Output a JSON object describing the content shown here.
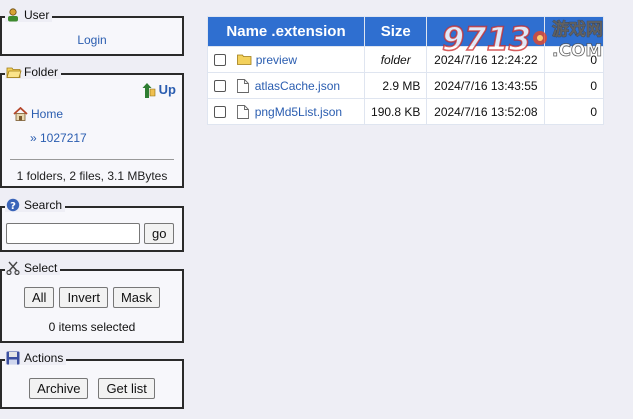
{
  "user": {
    "legend": "User",
    "login": "Login"
  },
  "folder": {
    "legend": "Folder",
    "up": "Up",
    "home": "Home",
    "current": "» 1027217",
    "summary": "1 folders, 2 files, 3.1 MBytes"
  },
  "search": {
    "legend": "Search",
    "value": "",
    "go": "go"
  },
  "select": {
    "legend": "Select",
    "all": "All",
    "invert": "Invert",
    "mask": "Mask",
    "status": "0 items selected"
  },
  "actions": {
    "legend": "Actions",
    "archive": "Archive",
    "getlist": "Get list"
  },
  "table": {
    "headers": {
      "name": "Name .extension",
      "size": "Size",
      "date": "",
      "count": ""
    },
    "rows": [
      {
        "name": "preview",
        "type": "folder",
        "size": "folder",
        "date": "2024/7/16 12:24:22",
        "count": "0"
      },
      {
        "name": "atlasCache.json",
        "type": "file",
        "size": "2.9 MB",
        "date": "2024/7/16 13:43:55",
        "count": "0"
      },
      {
        "name": "pngMd5List.json",
        "type": "file",
        "size": "190.8 KB",
        "date": "2024/7/16 13:52:08",
        "count": "0"
      }
    ]
  },
  "watermark": {
    "logo": "9713",
    "brand": "游戏网",
    "domain": ".COM"
  },
  "colors": {
    "header": "#2f6fd0",
    "link": "#2a5db0",
    "background": "#eeeef5"
  }
}
